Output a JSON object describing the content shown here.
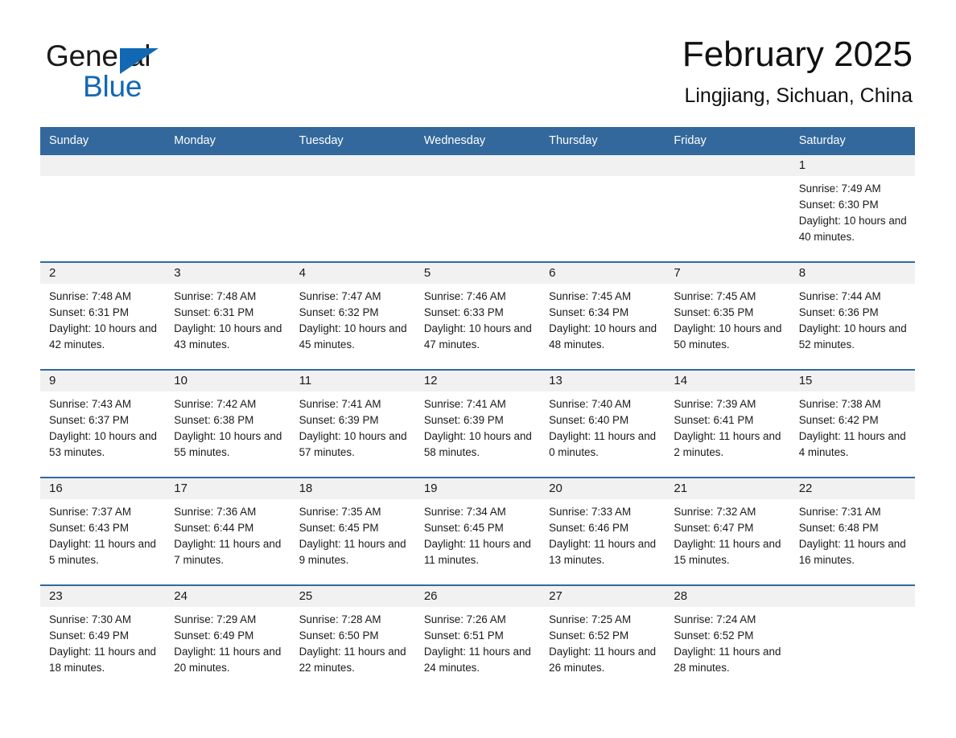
{
  "brand": {
    "name_part1": "General",
    "name_part2": "Blue",
    "accent_color": "#1268b3"
  },
  "header": {
    "month_title": "February 2025",
    "location": "Lingjiang, Sichuan, China"
  },
  "calendar": {
    "header_bg": "#33689c",
    "day_band_bg": "#f1f1f1",
    "weekday_headers": [
      "Sunday",
      "Monday",
      "Tuesday",
      "Wednesday",
      "Thursday",
      "Friday",
      "Saturday"
    ],
    "weeks": [
      [
        {
          "day": "",
          "sunrise": "",
          "sunset": "",
          "daylight": ""
        },
        {
          "day": "",
          "sunrise": "",
          "sunset": "",
          "daylight": ""
        },
        {
          "day": "",
          "sunrise": "",
          "sunset": "",
          "daylight": ""
        },
        {
          "day": "",
          "sunrise": "",
          "sunset": "",
          "daylight": ""
        },
        {
          "day": "",
          "sunrise": "",
          "sunset": "",
          "daylight": ""
        },
        {
          "day": "",
          "sunrise": "",
          "sunset": "",
          "daylight": ""
        },
        {
          "day": "1",
          "sunrise": "Sunrise: 7:49 AM",
          "sunset": "Sunset: 6:30 PM",
          "daylight": "Daylight: 10 hours and 40 minutes."
        }
      ],
      [
        {
          "day": "2",
          "sunrise": "Sunrise: 7:48 AM",
          "sunset": "Sunset: 6:31 PM",
          "daylight": "Daylight: 10 hours and 42 minutes."
        },
        {
          "day": "3",
          "sunrise": "Sunrise: 7:48 AM",
          "sunset": "Sunset: 6:31 PM",
          "daylight": "Daylight: 10 hours and 43 minutes."
        },
        {
          "day": "4",
          "sunrise": "Sunrise: 7:47 AM",
          "sunset": "Sunset: 6:32 PM",
          "daylight": "Daylight: 10 hours and 45 minutes."
        },
        {
          "day": "5",
          "sunrise": "Sunrise: 7:46 AM",
          "sunset": "Sunset: 6:33 PM",
          "daylight": "Daylight: 10 hours and 47 minutes."
        },
        {
          "day": "6",
          "sunrise": "Sunrise: 7:45 AM",
          "sunset": "Sunset: 6:34 PM",
          "daylight": "Daylight: 10 hours and 48 minutes."
        },
        {
          "day": "7",
          "sunrise": "Sunrise: 7:45 AM",
          "sunset": "Sunset: 6:35 PM",
          "daylight": "Daylight: 10 hours and 50 minutes."
        },
        {
          "day": "8",
          "sunrise": "Sunrise: 7:44 AM",
          "sunset": "Sunset: 6:36 PM",
          "daylight": "Daylight: 10 hours and 52 minutes."
        }
      ],
      [
        {
          "day": "9",
          "sunrise": "Sunrise: 7:43 AM",
          "sunset": "Sunset: 6:37 PM",
          "daylight": "Daylight: 10 hours and 53 minutes."
        },
        {
          "day": "10",
          "sunrise": "Sunrise: 7:42 AM",
          "sunset": "Sunset: 6:38 PM",
          "daylight": "Daylight: 10 hours and 55 minutes."
        },
        {
          "day": "11",
          "sunrise": "Sunrise: 7:41 AM",
          "sunset": "Sunset: 6:39 PM",
          "daylight": "Daylight: 10 hours and 57 minutes."
        },
        {
          "day": "12",
          "sunrise": "Sunrise: 7:41 AM",
          "sunset": "Sunset: 6:39 PM",
          "daylight": "Daylight: 10 hours and 58 minutes."
        },
        {
          "day": "13",
          "sunrise": "Sunrise: 7:40 AM",
          "sunset": "Sunset: 6:40 PM",
          "daylight": "Daylight: 11 hours and 0 minutes."
        },
        {
          "day": "14",
          "sunrise": "Sunrise: 7:39 AM",
          "sunset": "Sunset: 6:41 PM",
          "daylight": "Daylight: 11 hours and 2 minutes."
        },
        {
          "day": "15",
          "sunrise": "Sunrise: 7:38 AM",
          "sunset": "Sunset: 6:42 PM",
          "daylight": "Daylight: 11 hours and 4 minutes."
        }
      ],
      [
        {
          "day": "16",
          "sunrise": "Sunrise: 7:37 AM",
          "sunset": "Sunset: 6:43 PM",
          "daylight": "Daylight: 11 hours and 5 minutes."
        },
        {
          "day": "17",
          "sunrise": "Sunrise: 7:36 AM",
          "sunset": "Sunset: 6:44 PM",
          "daylight": "Daylight: 11 hours and 7 minutes."
        },
        {
          "day": "18",
          "sunrise": "Sunrise: 7:35 AM",
          "sunset": "Sunset: 6:45 PM",
          "daylight": "Daylight: 11 hours and 9 minutes."
        },
        {
          "day": "19",
          "sunrise": "Sunrise: 7:34 AM",
          "sunset": "Sunset: 6:45 PM",
          "daylight": "Daylight: 11 hours and 11 minutes."
        },
        {
          "day": "20",
          "sunrise": "Sunrise: 7:33 AM",
          "sunset": "Sunset: 6:46 PM",
          "daylight": "Daylight: 11 hours and 13 minutes."
        },
        {
          "day": "21",
          "sunrise": "Sunrise: 7:32 AM",
          "sunset": "Sunset: 6:47 PM",
          "daylight": "Daylight: 11 hours and 15 minutes."
        },
        {
          "day": "22",
          "sunrise": "Sunrise: 7:31 AM",
          "sunset": "Sunset: 6:48 PM",
          "daylight": "Daylight: 11 hours and 16 minutes."
        }
      ],
      [
        {
          "day": "23",
          "sunrise": "Sunrise: 7:30 AM",
          "sunset": "Sunset: 6:49 PM",
          "daylight": "Daylight: 11 hours and 18 minutes."
        },
        {
          "day": "24",
          "sunrise": "Sunrise: 7:29 AM",
          "sunset": "Sunset: 6:49 PM",
          "daylight": "Daylight: 11 hours and 20 minutes."
        },
        {
          "day": "25",
          "sunrise": "Sunrise: 7:28 AM",
          "sunset": "Sunset: 6:50 PM",
          "daylight": "Daylight: 11 hours and 22 minutes."
        },
        {
          "day": "26",
          "sunrise": "Sunrise: 7:26 AM",
          "sunset": "Sunset: 6:51 PM",
          "daylight": "Daylight: 11 hours and 24 minutes."
        },
        {
          "day": "27",
          "sunrise": "Sunrise: 7:25 AM",
          "sunset": "Sunset: 6:52 PM",
          "daylight": "Daylight: 11 hours and 26 minutes."
        },
        {
          "day": "28",
          "sunrise": "Sunrise: 7:24 AM",
          "sunset": "Sunset: 6:52 PM",
          "daylight": "Daylight: 11 hours and 28 minutes."
        },
        {
          "day": "",
          "sunrise": "",
          "sunset": "",
          "daylight": ""
        }
      ]
    ]
  }
}
